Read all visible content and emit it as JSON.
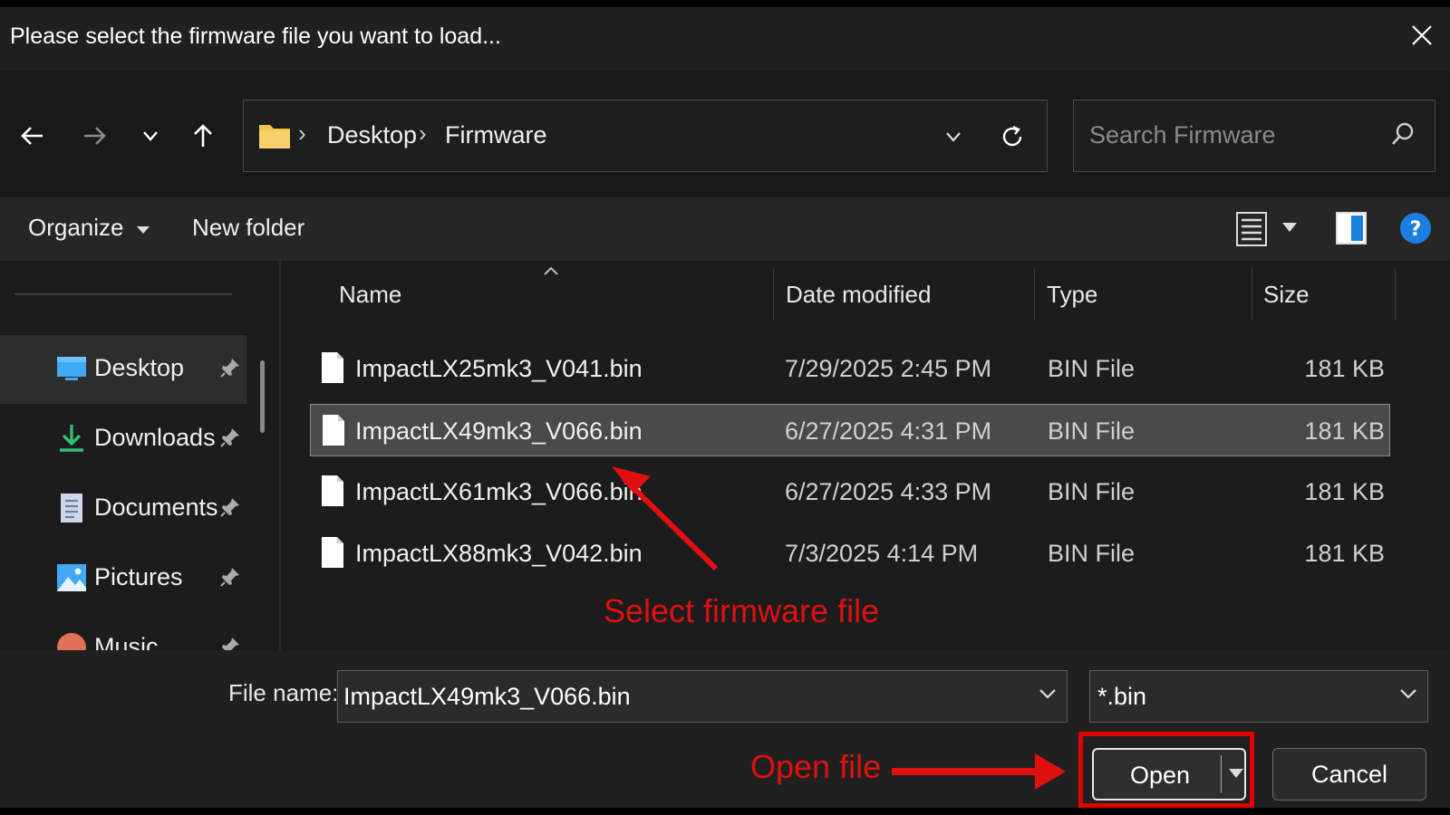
{
  "window": {
    "title": "Please select the firmware file you want to load..."
  },
  "address_bar": {
    "path": [
      "Desktop",
      "Firmware"
    ]
  },
  "search": {
    "placeholder": "Search Firmware"
  },
  "command_bar": {
    "organize_label": "Organize",
    "new_folder_label": "New folder"
  },
  "sidebar": {
    "items": [
      {
        "label": "Desktop",
        "icon": "desktop-icon",
        "active": true
      },
      {
        "label": "Downloads",
        "icon": "downloads-icon",
        "active": false
      },
      {
        "label": "Documents",
        "icon": "documents-icon",
        "active": false
      },
      {
        "label": "Pictures",
        "icon": "pictures-icon",
        "active": false
      },
      {
        "label": "Music",
        "icon": "music-icon",
        "active": false
      }
    ]
  },
  "file_list": {
    "columns": [
      "Name",
      "Date modified",
      "Type",
      "Size"
    ],
    "files": [
      {
        "name": "ImpactLX25mk3_V041.bin",
        "date": "7/29/2025 2:45 PM",
        "type": "BIN File",
        "size": "181 KB",
        "selected": false
      },
      {
        "name": "ImpactLX49mk3_V066.bin",
        "date": "6/27/2025 4:31 PM",
        "type": "BIN File",
        "size": "181 KB",
        "selected": true
      },
      {
        "name": "ImpactLX61mk3_V066.bin",
        "date": "6/27/2025 4:33 PM",
        "type": "BIN File",
        "size": "181 KB",
        "selected": false
      },
      {
        "name": "ImpactLX88mk3_V042.bin",
        "date": "7/3/2025 4:14 PM",
        "type": "BIN File",
        "size": "181 KB",
        "selected": false
      }
    ]
  },
  "footer": {
    "file_name_label": "File name:",
    "file_name_value": "ImpactLX49mk3_V066.bin",
    "file_type_value": "*.bin",
    "open_label": "Open",
    "cancel_label": "Cancel"
  },
  "annotations": {
    "select_text": "Select firmware file",
    "open_text": "Open file",
    "color": "#e01010"
  },
  "colors": {
    "help_accent": "#1a7fe0",
    "folder_yellow": "#f2c14e"
  }
}
